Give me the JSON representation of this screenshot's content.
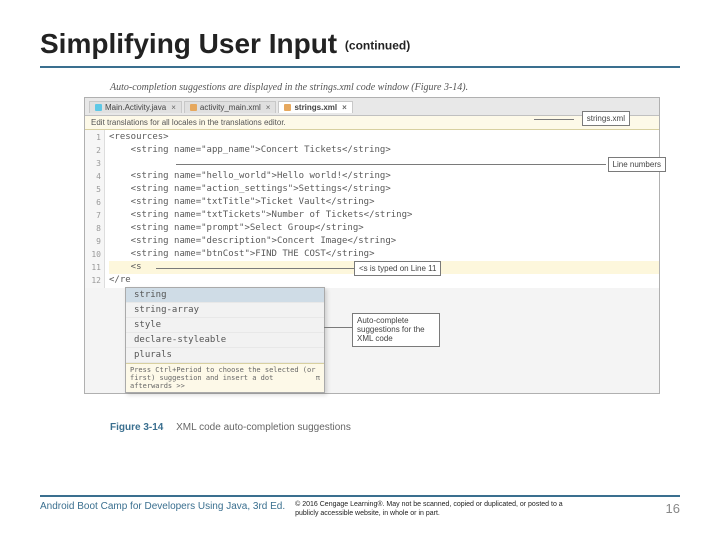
{
  "title": "Simplifying User Input",
  "title_tag": "(continued)",
  "figure_intro": "Auto-completion suggestions are displayed in the strings.xml code window (Figure 3-14).",
  "tabs": {
    "t0": "Main.Activity.java",
    "t1": "activity_main.xml",
    "t2": "strings.xml"
  },
  "banner": "Edit translations for all locales in the translations editor.",
  "gutter": [
    "1",
    "2",
    "3",
    "4",
    "5",
    "6",
    "7",
    "8",
    "9",
    "10",
    "11",
    "12"
  ],
  "lines": {
    "l1": "<resources>",
    "l2": "    <string name=\"app_name\">Concert Tickets</string>",
    "l3": "",
    "l4": "    <string name=\"hello_world\">Hello world!</string>",
    "l5": "    <string name=\"action_settings\">Settings</string>",
    "l6": "    <string name=\"txtTitle\">Ticket Vault</string>",
    "l7": "    <string name=\"txtTickets\">Number of Tickets</string>",
    "l8": "    <string name=\"prompt\">Select Group</string>",
    "l9": "    <string name=\"description\">Concert Image</string>",
    "l10": "    <string name=\"btnCost\">FIND THE COST</string>",
    "l11": "    <s",
    "l12": "</re"
  },
  "dropdown": {
    "items": [
      "string",
      "string-array",
      "style",
      "declare-styleable",
      "plurals"
    ],
    "hint": "Press Ctrl+Period to choose the selected (or first) suggestion and insert a dot afterwards  >>",
    "pi": "π"
  },
  "callouts": {
    "file": "strings.xml",
    "linenum": "Line numbers",
    "typed": "<s is typed on Line 11",
    "auto": "Auto-complete suggestions for the XML code"
  },
  "caption": {
    "num": "Figure 3-14",
    "text": "XML code auto-completion suggestions"
  },
  "footer": {
    "book": "Android Boot Camp for Developers Using Java, 3rd Ed.",
    "copyright": "© 2016 Cengage Learning®. May not be scanned, copied or duplicated, or posted to a publicly accessible website, in whole or in part.",
    "page": "16"
  }
}
